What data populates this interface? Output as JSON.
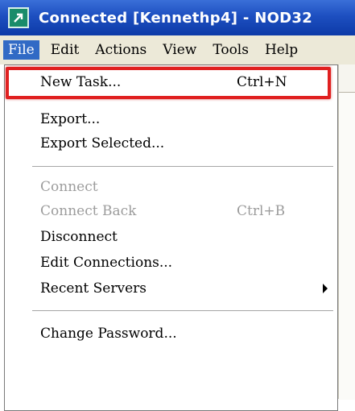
{
  "window": {
    "title": "Connected [Kennethp4] - NOD32"
  },
  "menubar": {
    "items": [
      {
        "label": "File",
        "active": true
      },
      {
        "label": "Edit"
      },
      {
        "label": "Actions"
      },
      {
        "label": "View"
      },
      {
        "label": "Tools"
      },
      {
        "label": "Help"
      }
    ]
  },
  "file_menu": {
    "items": [
      {
        "label": "New Task...",
        "shortcut": "Ctrl+N",
        "enabled": true,
        "highlighted": true
      },
      {
        "label": "Export...",
        "enabled": true
      },
      {
        "label": "Export Selected...",
        "enabled": true
      },
      {
        "label": "Connect",
        "enabled": false
      },
      {
        "label": "Connect Back",
        "shortcut": "Ctrl+B",
        "enabled": false
      },
      {
        "label": "Disconnect",
        "enabled": true
      },
      {
        "label": "Edit Connections...",
        "enabled": true
      },
      {
        "label": "Recent Servers",
        "enabled": true,
        "submenu": true
      },
      {
        "label": "Change Password...",
        "enabled": true
      }
    ]
  },
  "colors": {
    "highlight_border": "#e02020",
    "menu_active_bg": "#316ac5",
    "titlebar": "#1d4fc0",
    "disabled_text": "#9c9c9c"
  }
}
